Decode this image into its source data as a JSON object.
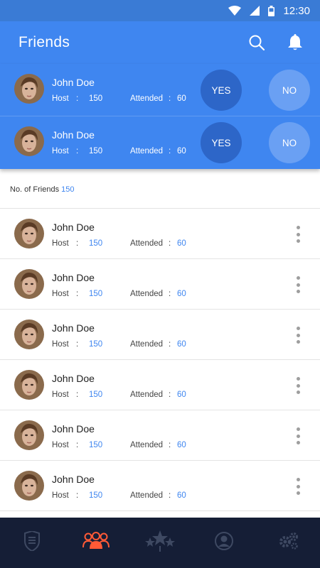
{
  "status_bar": {
    "time": "12:30"
  },
  "app_bar": {
    "title": "Friends",
    "search_icon": "search-icon",
    "notification_icon": "bell-icon"
  },
  "colors": {
    "primary": "#3f86f0",
    "yes": "#2d66c8",
    "no": "#6aa0f3",
    "nav_bg": "#151e36",
    "nav_active": "#ff5a36",
    "nav_inactive": "#3e4962"
  },
  "requests": [
    {
      "name": "John Doe",
      "host_label": "Host",
      "host_value": "150",
      "attended_label": "Attended",
      "attended_value": "60",
      "yes_label": "YES",
      "no_label": "NO"
    },
    {
      "name": "John Doe",
      "host_label": "Host",
      "host_value": "150",
      "attended_label": "Attended",
      "attended_value": "60",
      "yes_label": "YES",
      "no_label": "NO"
    }
  ],
  "friends_count": {
    "label": "No. of Friends",
    "value": "150"
  },
  "friends": [
    {
      "name": "John Doe",
      "host_label": "Host",
      "host_value": "150",
      "attended_label": "Attended",
      "attended_value": "60"
    },
    {
      "name": "John Doe",
      "host_label": "Host",
      "host_value": "150",
      "attended_label": "Attended",
      "attended_value": "60"
    },
    {
      "name": "John Doe",
      "host_label": "Host",
      "host_value": "150",
      "attended_label": "Attended",
      "attended_value": "60"
    },
    {
      "name": "John Doe",
      "host_label": "Host",
      "host_value": "150",
      "attended_label": "Attended",
      "attended_value": "60"
    },
    {
      "name": "John Doe",
      "host_label": "Host",
      "host_value": "150",
      "attended_label": "Attended",
      "attended_value": "60"
    },
    {
      "name": "John Doe",
      "host_label": "Host",
      "host_value": "150",
      "attended_label": "Attended",
      "attended_value": "60"
    }
  ],
  "bottom_nav": [
    {
      "icon": "list-badge-icon",
      "active": false
    },
    {
      "icon": "people-group-icon",
      "active": true
    },
    {
      "icon": "stars-fireworks-icon",
      "active": false
    },
    {
      "icon": "profile-icon",
      "active": false
    },
    {
      "icon": "gears-icon",
      "active": false
    }
  ]
}
